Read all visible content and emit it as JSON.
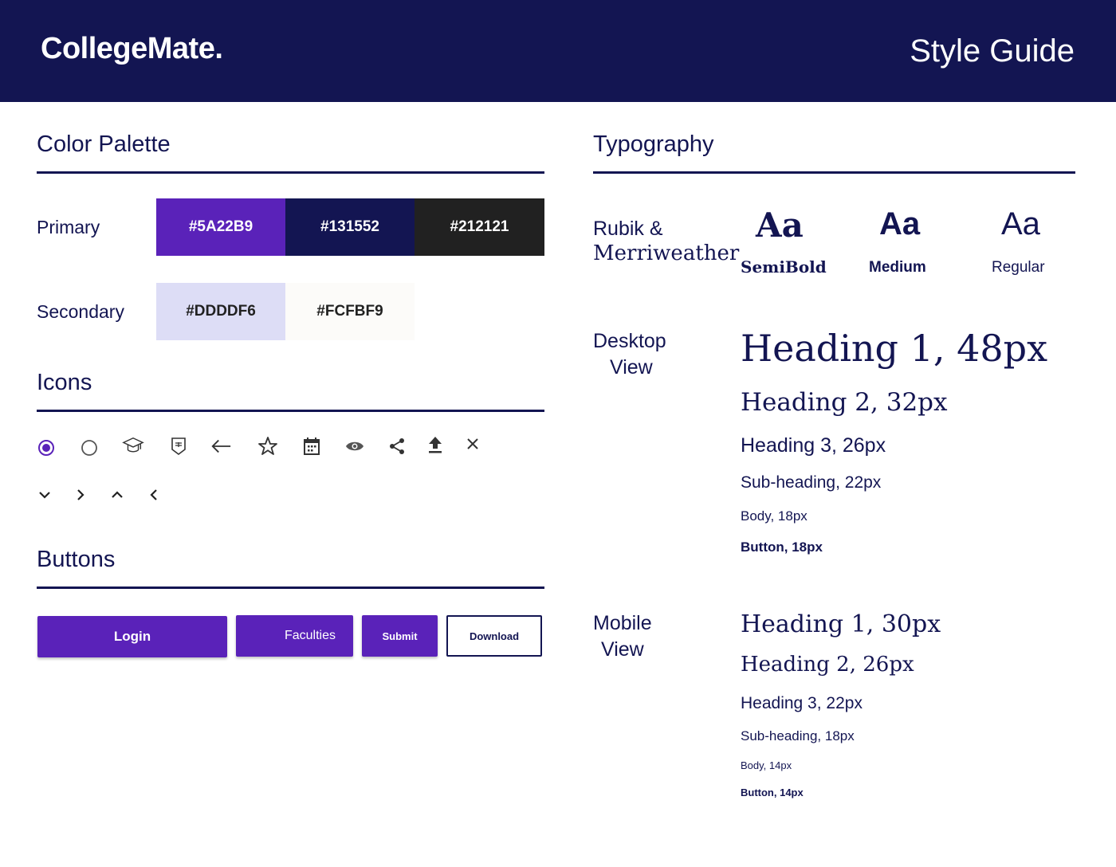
{
  "header": {
    "logo": "CollegeMate.",
    "title": "Style Guide"
  },
  "palette": {
    "title": "Color Palette",
    "primary_label": "Primary",
    "secondary_label": "Secondary",
    "primary": [
      {
        "label": "#5A22B9",
        "color": "#5A22B9",
        "text_color": "#FFFFFF"
      },
      {
        "label": "#131552",
        "color": "#131552",
        "text_color": "#FFFFFF"
      },
      {
        "label": "#212121",
        "color": "#212121",
        "text_color": "#FFFFFF"
      }
    ],
    "secondary": [
      {
        "label": "#DDDDF6",
        "color": "#DDDDF6",
        "text_color": "#212121"
      },
      {
        "label": "#FCFBF9",
        "color": "#FCFBF9",
        "text_color": "#212121"
      }
    ]
  },
  "icons": {
    "title": "Icons",
    "row1": [
      "radio-checked-icon",
      "radio-unchecked-icon",
      "graduation-cap-icon",
      "book-badge-icon",
      "arrow-left-icon",
      "star-outline-icon",
      "calendar-icon",
      "eye-icon",
      "share-icon",
      "upload-icon",
      "close-icon"
    ],
    "row2": [
      "chevron-down-icon",
      "chevron-right-icon",
      "chevron-up-icon",
      "chevron-left-icon"
    ]
  },
  "buttons": {
    "title": "Buttons",
    "login": "Login",
    "faculties": "Faculties",
    "submit": "Submit",
    "download": "Download",
    "accent": "#5A22B9"
  },
  "typography": {
    "title": "Typography",
    "fonts_label_line1": "Rubik &",
    "fonts_label_line2": "Merriweather",
    "samples": [
      {
        "glyph": "Aa",
        "weight": "SemiBold"
      },
      {
        "glyph": "Aa",
        "weight": "Medium"
      },
      {
        "glyph": "Aa",
        "weight": "Regular"
      }
    ],
    "desktop_label_line1": "Desktop",
    "desktop_label_line2": "View",
    "desktop": {
      "h1": "Heading 1, 48px",
      "h2": "Heading 2, 32px",
      "h3": "Heading 3, 26px",
      "sub": "Sub-heading, 22px",
      "body": "Body, 18px",
      "button": "Button, 18px"
    },
    "mobile_label_line1": "Mobile",
    "mobile_label_line2": "View",
    "mobile": {
      "h1": "Heading 1, 30px",
      "h2": "Heading 2, 26px",
      "h3": "Heading 3, 22px",
      "sub": "Sub-heading, 18px",
      "body": "Body, 14px",
      "button": "Button, 14px"
    }
  }
}
